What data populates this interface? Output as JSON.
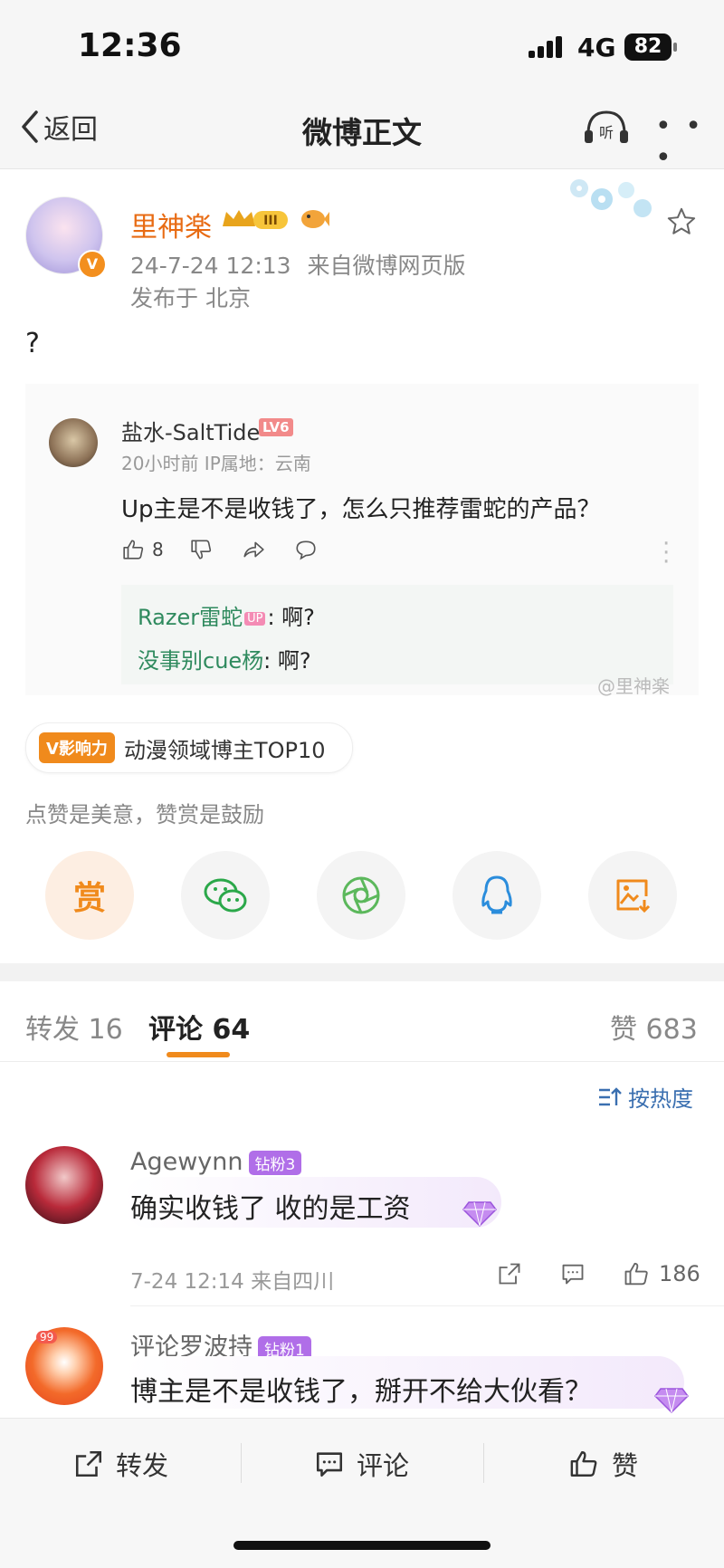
{
  "status_bar": {
    "time": "12:36",
    "network": "4G",
    "battery": "82"
  },
  "nav": {
    "back_label": "返回",
    "title": "微博正文",
    "listen_label": "听"
  },
  "post": {
    "author": "里神楽",
    "level_badge": "III",
    "timestamp": "24-7-24 12:13",
    "source": "来自微博网页版",
    "location": "发布于 北京",
    "text": "?",
    "embedded_comment": {
      "username": "盐水-SaltTide",
      "level": "LV6",
      "meta": "20小时前  IP属地：云南",
      "text": "Up主是不是收钱了，怎么只推荐雷蛇的产品？",
      "likes": "8",
      "replies": [
        {
          "name": "Razer雷蛇",
          "badge": "UP",
          "text": ": 啊?"
        },
        {
          "name": "没事别cue杨",
          "text": ": 啊?"
        }
      ],
      "watermark": "@里神楽"
    },
    "influence_badge": "V影响力",
    "influence_text": "动漫领域博主TOP10",
    "like_hint": "点赞是美意，赞赏是鼓励",
    "reward_label": "赏"
  },
  "tabs": {
    "repost": "转发 16",
    "comment": "评论 64",
    "like": "赞 683"
  },
  "sort_label": "按热度",
  "comments": [
    {
      "name": "Agewynn",
      "fan_badge": "钻粉3",
      "text": "确实收钱了 收的是工资",
      "meta": "7-24 12:14  来自四川",
      "likes": "186"
    },
    {
      "name": "评论罗波持",
      "fan_badge": "钻粉1",
      "avatar_badge": "99",
      "text": "博主是不是收钱了，掰开不给大伙看？"
    }
  ],
  "bottom_bar": {
    "repost": "转发",
    "comment": "评论",
    "like": "赞"
  },
  "colors": {
    "accent": "#f08a1c",
    "username": "#e86b13",
    "link_blue": "#3a6fb0",
    "fan_purple": "#b06ee8"
  }
}
